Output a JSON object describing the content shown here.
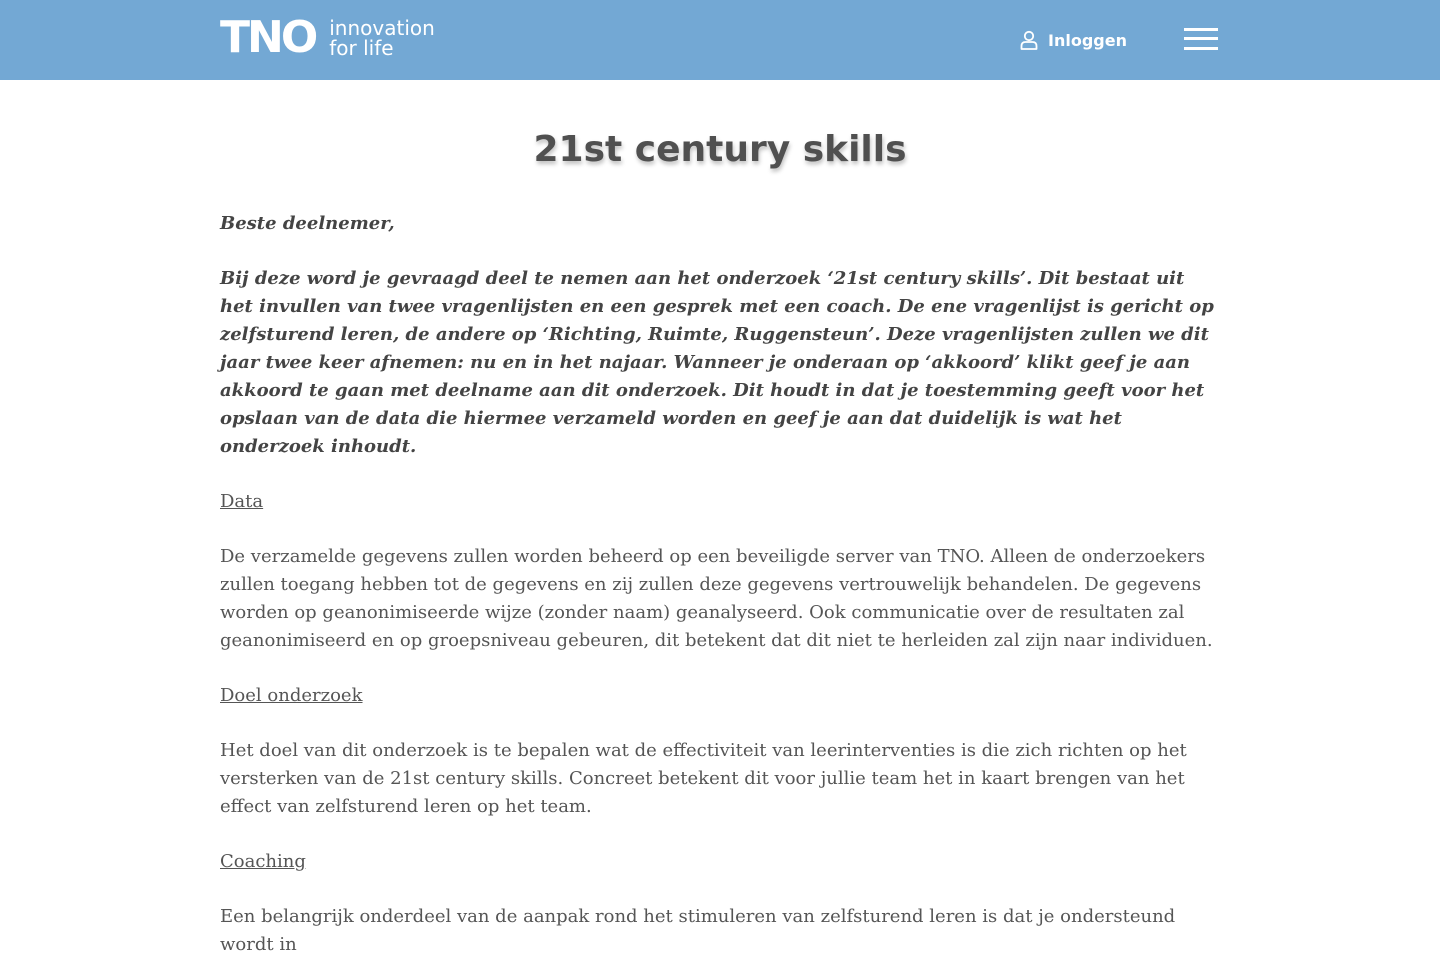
{
  "header": {
    "logo_mark": "TNO",
    "logo_tag_line1": "innovation",
    "logo_tag_line2": "for life",
    "login_label": "Inloggen",
    "colors": {
      "bar": "#73a8d4",
      "text": "#ffffff"
    },
    "icons": {
      "login": "user-icon",
      "menu": "hamburger-menu-icon"
    }
  },
  "main": {
    "title": "21st century skills",
    "greeting": "Beste deelnemer,",
    "intro": "Bij deze word je gevraagd deel te nemen aan het onderzoek ‘21st century skills’. Dit bestaat uit het invullen van twee vragenlijsten en een gesprek met een coach. De ene vragenlijst is gericht op zelfsturend leren, de andere op ‘Richting, Ruimte, Ruggensteun’. Deze vragenlijsten zullen we dit jaar twee keer afnemen: nu en in het najaar. Wanneer je onderaan op ‘akkoord’ klikt geef je aan akkoord te gaan met deelname aan dit onderzoek. Dit houdt in dat je toestemming geeft voor het opslaan van de data die hiermee verzameld worden en geef je aan dat duidelijk is wat het onderzoek inhoudt.",
    "sections": [
      {
        "heading": "Data",
        "text": "De verzamelde gegevens zullen worden beheerd op een beveiligde server van TNO. Alleen de onderzoekers zullen toegang hebben tot de gegevens en zij zullen deze gegevens vertrouwelijk behandelen. De gegevens worden op geanonimiseerde wijze (zonder naam) geanalyseerd. Ook communicatie over de resultaten zal geanonimiseerd en op groepsniveau gebeuren, dit betekent dat dit niet te herleiden zal zijn naar individuen."
      },
      {
        "heading": "Doel onderzoek",
        "text": "Het doel van dit onderzoek is te bepalen wat de effectiviteit van leerinterventies is die zich richten op het versterken van de 21st century skills. Concreet betekent dit voor jullie team het in kaart brengen van het effect van zelfsturend leren op het team."
      },
      {
        "heading": "Coaching",
        "text": "Een belangrijk onderdeel van de aanpak rond het stimuleren van zelfsturend leren is dat je ondersteund wordt in"
      }
    ]
  }
}
